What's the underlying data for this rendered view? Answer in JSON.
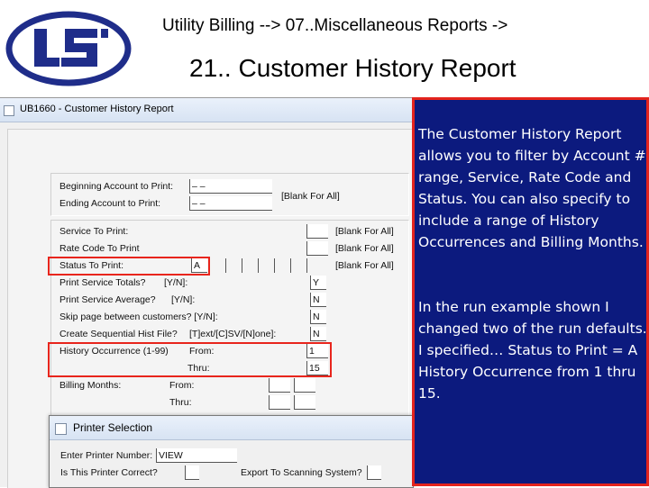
{
  "header": {
    "breadcrumb": "Utility Billing -->   07..Miscellaneous Reports ->",
    "title": "21.. Customer History Report"
  },
  "window": {
    "title": "UB1660 - Customer History Report",
    "fields": {
      "begin_account_label": "Beginning Account to Print:",
      "end_account_label": "Ending    Account to Print:",
      "begin_account_value": "  –          –",
      "end_account_value": "  –          –",
      "blank_for_all": "[Blank For All]",
      "service_label": "Service To Print:",
      "rate_code_label": "Rate Code To Print",
      "status_label": "Status To Print:",
      "status_value": "A",
      "service_hint": "[Blank For All]",
      "rate_code_hint": "[Blank For All]",
      "status_hint": "[Blank For All]",
      "service_totals_label": "Print Service Totals?",
      "service_totals_hint": "[Y/N]:",
      "service_totals_value": "Y",
      "service_average_label": "Print Service Average?",
      "service_average_hint": "[Y/N]:",
      "service_average_value": "N",
      "skip_page_label": "Skip page between customers? [Y/N]:",
      "skip_page_value": "N",
      "seq_file_label": "Create Sequential Hist File?",
      "seq_file_hint": "[T]ext/[C]SV/[N]one]:",
      "seq_file_value": "N",
      "history_label": "History Occurrence  (1-99)",
      "history_from_label": "From:",
      "history_from_value": "1",
      "history_thru_label": "Thru:",
      "history_thru_value": "15",
      "billing_label": "Billing Months:",
      "billing_from_label": "From:",
      "billing_thru_label": "Thru:"
    }
  },
  "printer_dialog": {
    "title": "Printer Selection",
    "printer_label": "Enter Printer Number:",
    "printer_value": "VIEW",
    "correct_label": "Is This Printer Correct?",
    "export_label": "Export To Scanning System?"
  },
  "callout": {
    "paragraph1": "The Customer History Report allows you to filter by Account # range,  Service,  Rate Code and  Status.  You can also specify to include a range of History Occurrences  and Billing Months.",
    "paragraph2": "In the run example shown I changed two of the run defaults.  I specified… Status to Print = A History Occurrence from 1 thru 15."
  },
  "colors": {
    "callout_bg": "#0c1a7e",
    "highlight_red": "#e8251c",
    "logo_blue": "#1f2d8a"
  },
  "icons": [
    "logo-icon",
    "window-icon"
  ]
}
